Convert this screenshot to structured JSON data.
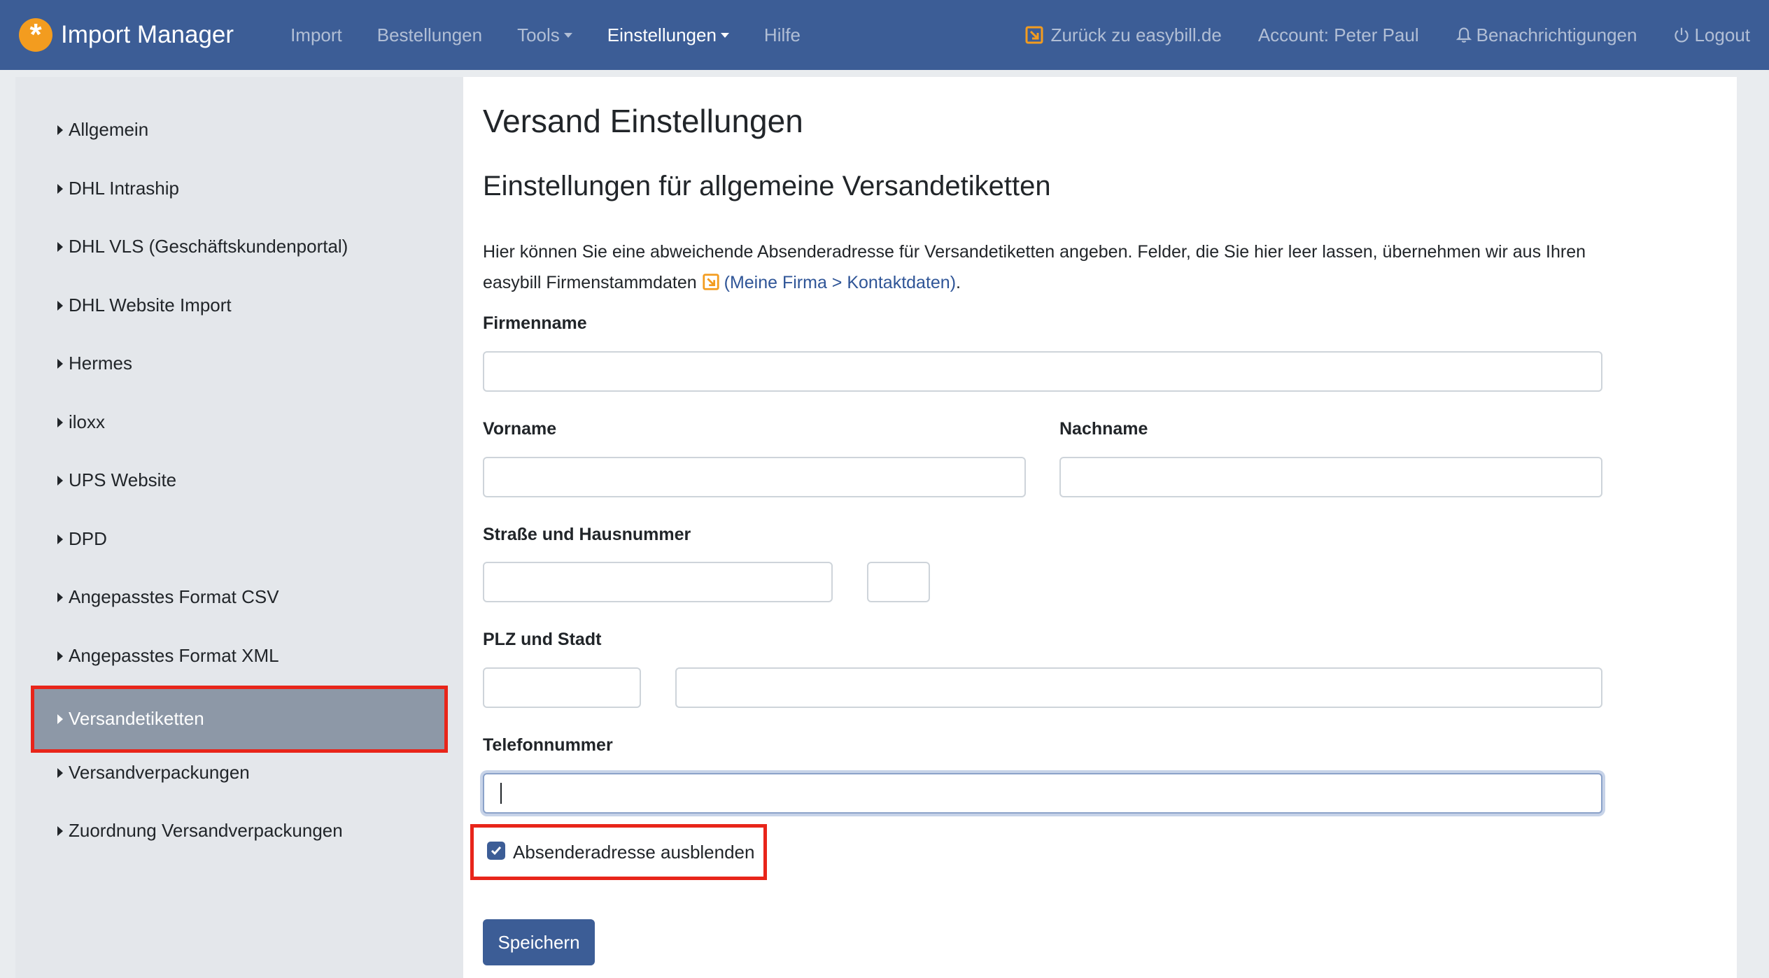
{
  "app": {
    "title": "Import Manager",
    "logo_icon": "asterisk-logo-icon",
    "logo_symbol": "*"
  },
  "nav": {
    "items": [
      {
        "label": "Import",
        "active": false
      },
      {
        "label": "Bestellungen",
        "active": false
      },
      {
        "label": "Tools",
        "active": false,
        "dropdown": true
      },
      {
        "label": "Einstellungen",
        "active": true,
        "dropdown": true
      },
      {
        "label": "Hilfe",
        "active": false
      }
    ],
    "back_link": "Zurück zu easybill.de",
    "account": "Account: Peter Paul",
    "notifications": "Benachrichtigungen",
    "logout": "Logout"
  },
  "sidebar": {
    "items": [
      "Allgemein",
      "DHL Intraship",
      "DHL VLS (Geschäftskundenportal)",
      "DHL Website Import",
      "Hermes",
      "iloxx",
      "UPS Website",
      "DPD",
      "Angepasstes Format CSV",
      "Angepasstes Format XML",
      "Versandetiketten",
      "Versandverpackungen",
      "Zuordnung Versandverpackungen"
    ],
    "active": "Versandetiketten"
  },
  "main": {
    "title": "Versand Einstellungen",
    "subtitle": "Einstellungen für allgemeine Versandetiketten",
    "description_part1": "Hier können Sie eine abweichende Absenderadresse für Versandetiketten angeben. Felder, die Sie hier leer lassen, übernehmen wir aus Ihren easybill Firmenstammdaten",
    "description_link": "(Meine Firma > Kontaktdaten)",
    "description_end": ".",
    "form": {
      "firmenname_label": "Firmenname",
      "firmenname_value": "",
      "vorname_label": "Vorname",
      "vorname_value": "",
      "nachname_label": "Nachname",
      "nachname_value": "",
      "strasse_label": "Straße und Hausnummer",
      "strasse_value": "",
      "hausnummer_value": "",
      "plz_stadt_label": "PLZ und Stadt",
      "plz_value": "",
      "stadt_value": "",
      "telefon_label": "Telefonnummer",
      "telefon_value": "",
      "hide_sender_label": "Absenderadresse ausblenden",
      "hide_sender_checked": true,
      "save_label": "Speichern"
    }
  },
  "colors": {
    "navbar": "#3c5d96",
    "accent_orange": "#f39c1f",
    "highlight_red": "#e8251a",
    "sidebar_active": "#8d98a7"
  }
}
